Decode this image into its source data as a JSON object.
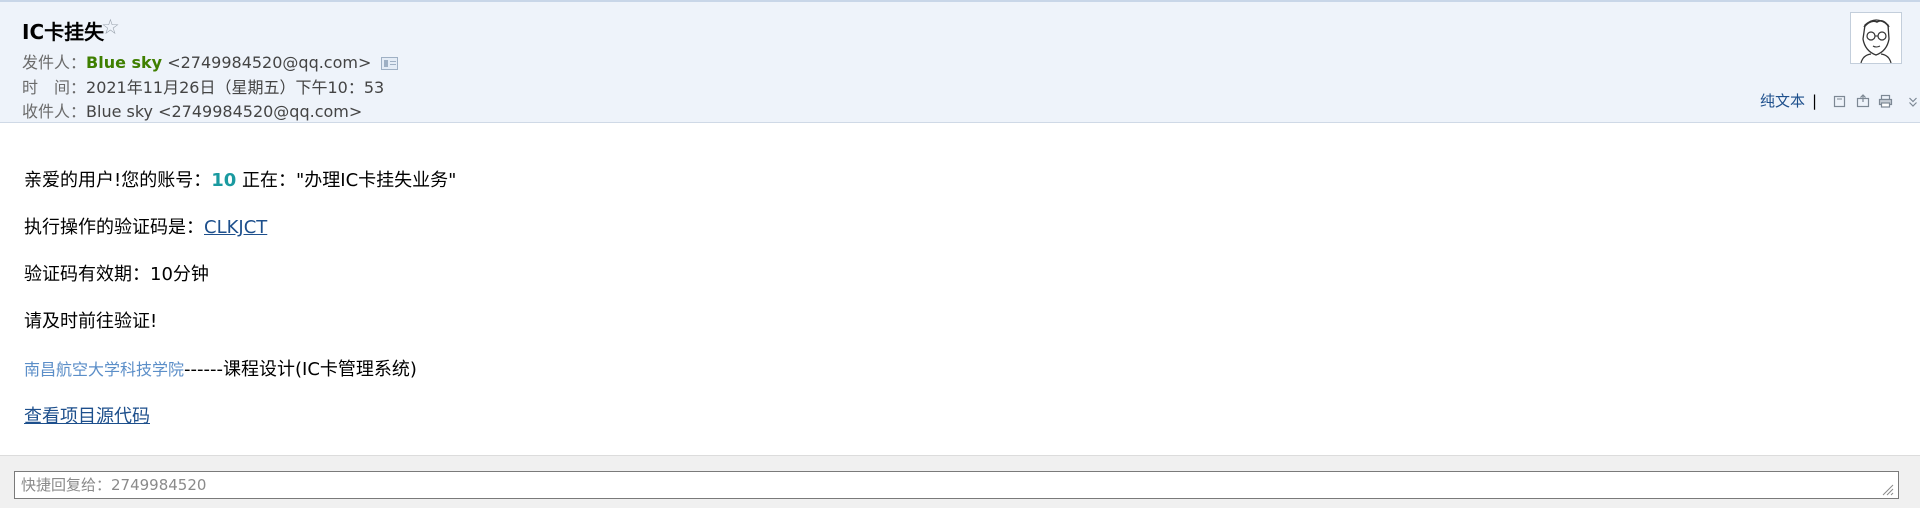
{
  "email": {
    "subject": "IC卡挂失",
    "star_icon": "star-outline-icon",
    "from_label": "发件人：",
    "from_name": "Blue sky",
    "from_addr": "<2749984520@qq.com>",
    "time_label": "时　间：",
    "time_value": "2021年11月26日（星期五）下午10：53",
    "to_label": "收件人：",
    "to_value": "Blue sky <2749984520@qq.com>"
  },
  "toolbar": {
    "plain_text": "纯文本",
    "separator": "|",
    "icons": [
      "new-window-icon",
      "export-icon",
      "print-icon",
      "chevron-down-icon"
    ]
  },
  "body": {
    "line1_pre": "亲爱的用户!您的账号：",
    "line1_num": "10",
    "line1_post": " 正在：\"办理IC卡挂失业务\"",
    "line2_pre": "执行操作的验证码是：",
    "line2_code": "CLKJCT",
    "line3": "验证码有效期：10分钟",
    "line4": "请及时前往验证!",
    "line5_school": "南昌航空大学科技学院",
    "line5_post": "------课程设计(IC卡管理系统)",
    "line6_link": "查看项目源代码"
  },
  "reply": {
    "placeholder": "快捷回复给：2749984520"
  },
  "colors": {
    "header_bg": "#eef3fa",
    "sender_green": "#3f7f00",
    "link_blue": "#1d4f8c",
    "accent_teal": "#1a9aa0"
  }
}
